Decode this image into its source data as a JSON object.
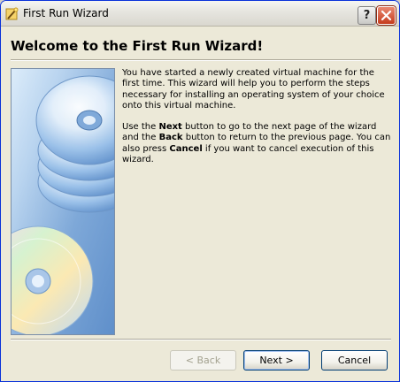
{
  "window": {
    "title": "First Run Wizard",
    "help_label": "?",
    "close_label": "✕"
  },
  "page": {
    "heading": "Welcome to the First Run Wizard!",
    "para1": "You have started a newly created virtual machine for the first time. This wizard will help you to perform the steps necessary for installing an operating system of your choice onto this virtual machine.",
    "para2_pre": "Use the ",
    "para2_next": "Next",
    "para2_mid1": " button to go to the next page of the wizard and the ",
    "para2_back": "Back",
    "para2_mid2": " button to return to the previous page. You can also press ",
    "para2_cancel": "Cancel",
    "para2_post": " if you want to cancel execution of this wizard."
  },
  "buttons": {
    "back": "< Back",
    "next": "Next >",
    "cancel": "Cancel"
  },
  "colors": {
    "window_border": "#0831d9",
    "background": "#ece9d8",
    "close_button": "#c53b1c"
  }
}
